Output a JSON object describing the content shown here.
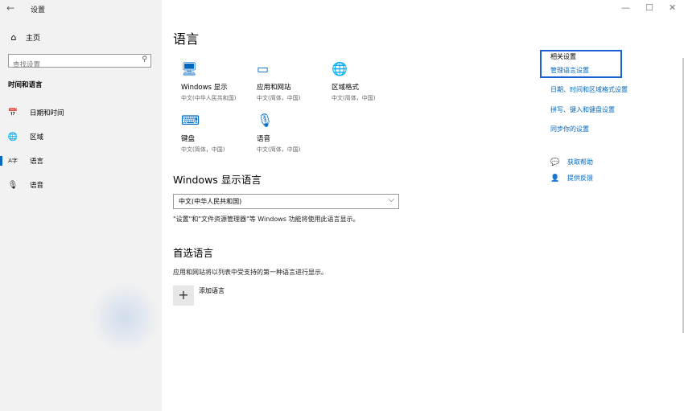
{
  "window": {
    "back_icon": "←",
    "title": "设置",
    "minimize_icon": "—",
    "maximize_icon": "☐",
    "close_icon": "✕"
  },
  "sidebar": {
    "home_icon": "⌂",
    "home_label": "主页",
    "search_placeholder": "查找设置",
    "search_icon": "⚲",
    "section_title": "时间和语言",
    "items": [
      {
        "icon": "📅",
        "label": "日期和时间"
      },
      {
        "icon": "🌐",
        "label": "区域"
      },
      {
        "icon": "A字",
        "label": "语言",
        "active": true
      },
      {
        "icon": "🎙",
        "label": "语音"
      }
    ]
  },
  "main": {
    "title": "语言",
    "tiles": [
      {
        "icon": "🖥",
        "label": "Windows 显示",
        "sub": "中文(中华人民共和国)"
      },
      {
        "icon": "▭",
        "label": "应用和网站",
        "sub": "中文(简体，中国)"
      },
      {
        "icon": "🌐",
        "label": "区域格式",
        "sub": "中文(简体，中国)"
      },
      {
        "icon": "⌨",
        "label": "键盘",
        "sub": "中文(简体，中国)"
      },
      {
        "icon": "🎙",
        "label": "语音",
        "sub": "中文(简体，中国)"
      }
    ],
    "display_lang_heading": "Windows 显示语言",
    "display_lang_value": "中文(中华人民共和国)",
    "display_lang_note": "\"设置\"和\"文件资源管理器\"等 Windows 功能将使用此语言显示。",
    "preferred_heading": "首选语言",
    "preferred_note": "应用和网站将以列表中受支持的第一种语言进行显示。",
    "add_icon": "+",
    "add_label": "添加语言"
  },
  "related": {
    "title": "相关设置",
    "links": [
      "管理语言设置",
      "日期、时间和区域格式设置",
      "拼写、键入和键盘设置",
      "同步你的设置"
    ],
    "help": [
      {
        "icon": "💬",
        "label": "获取帮助"
      },
      {
        "icon": "👤",
        "label": "提供反馈"
      }
    ]
  }
}
